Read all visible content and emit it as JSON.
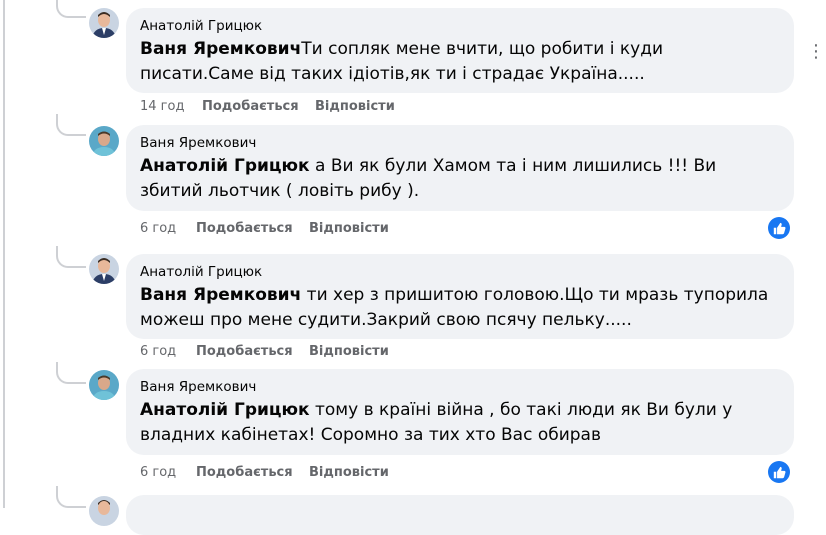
{
  "comments": [
    {
      "author": "Анатолій Грицюк",
      "mention": "Ваня Яремкович",
      "text": "Ти сопляк мене вчити, що робити і куди писати.Саме від таких ідіотів,як ти і страдає Україна.....",
      "time": "14 год",
      "like_label": "Подобається",
      "reply_label": "Відповісти",
      "avatar": "avatar-anatoliy",
      "has_like_badge": false
    },
    {
      "author": "Ваня Яремкович",
      "mention": "Анатолій Грицюк",
      "text": " а Ви як були Хамом та і ним лишились !!! Ви збитий льотчик ( ловіть рибу ).",
      "time": "6 год",
      "like_label": "Подобається",
      "reply_label": "Відповісти",
      "avatar": "avatar-vanya",
      "has_like_badge": true
    },
    {
      "author": "Анатолій Грицюк",
      "mention": "Ваня Яремкович",
      "text": " ти хер з пришитою головою.Що ти мразь тупорила можеш про мене судити.Закрий свою псячу пельку.....",
      "time": "6 год",
      "like_label": "Подобається",
      "reply_label": "Відповісти",
      "avatar": "avatar-anatoliy",
      "has_like_badge": false
    },
    {
      "author": "Ваня Яремкович",
      "mention": "Анатолій Грицюк",
      "text": " тому в країні війна , бо такі люди як Ви були у владних кабінетах! Соромно за тих хто Вас обирав",
      "time": "6 год",
      "like_label": "Подобається",
      "reply_label": "Відповісти",
      "avatar": "avatar-vanya",
      "has_like_badge": true
    }
  ],
  "icons": {
    "more": "more-options-icon",
    "like": "like-reaction-icon"
  },
  "colors": {
    "bubble": "#f0f2f5",
    "meta": "#65676b",
    "like_blue": "#1877f2"
  }
}
